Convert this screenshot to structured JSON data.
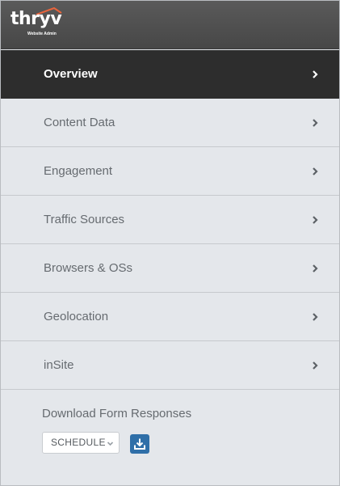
{
  "logo": {
    "wordmark": "thryv",
    "subtitle": "Website Admin",
    "roof_color": "#e8643c"
  },
  "colors": {
    "header_bg": "#4f4f4f",
    "active_bg": "#2d2d2d",
    "panel_bg": "#e4e7eb",
    "accent": "#2f6fa8"
  },
  "menu": {
    "items": [
      {
        "label": "Overview",
        "active": true,
        "icon": "chevron-right-icon"
      },
      {
        "label": "Content Data",
        "active": false,
        "icon": "chevron-right-icon"
      },
      {
        "label": "Engagement",
        "active": false,
        "icon": "chevron-right-icon"
      },
      {
        "label": "Traffic Sources",
        "active": false,
        "icon": "chevron-right-icon"
      },
      {
        "label": "Browsers & OSs",
        "active": false,
        "icon": "chevron-right-icon"
      },
      {
        "label": "Geolocation",
        "active": false,
        "icon": "chevron-right-icon"
      },
      {
        "label": "inSite",
        "active": false,
        "icon": "chevron-right-icon"
      }
    ]
  },
  "download": {
    "title": "Download Form Responses",
    "select_value": "SCHEDULE",
    "button_icon": "download-icon"
  }
}
